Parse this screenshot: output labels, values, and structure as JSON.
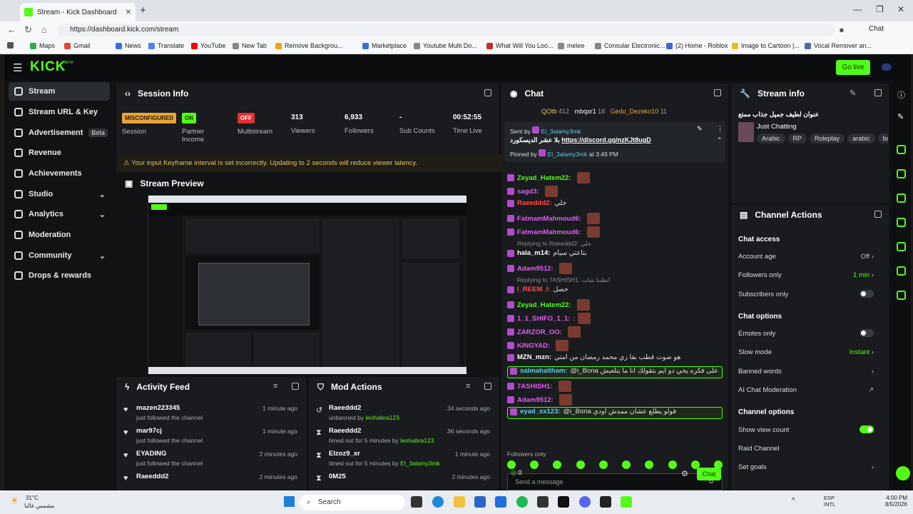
{
  "browser": {
    "tab_title": "Stream - Kick Dashboard",
    "url": "https://dashboard.kick.com/stream",
    "chat_label": "Chat",
    "bookmarks": [
      "Maps",
      "Gmail",
      "News",
      "Translate",
      "YouTube",
      "New Tab",
      "Remove Backgrou...",
      "Marketplace",
      "Youtube Multi Do...",
      "What Will You Loo...",
      "melee",
      "Consular Electronic...",
      "(2) Home - Roblox",
      "Image to Cartoon |...",
      "Vocal Remover an..."
    ]
  },
  "app": {
    "logo": "KICK",
    "logo_beta": "BETA",
    "go_live": "Go live"
  },
  "sidebar": {
    "items": [
      {
        "label": "Stream",
        "icon": "broadcast-icon"
      },
      {
        "label": "Stream URL & Key",
        "icon": "link-icon"
      },
      {
        "label": "Advertisement",
        "icon": "ad-icon",
        "badge": "Beta"
      },
      {
        "label": "Revenue",
        "icon": "revenue-icon"
      },
      {
        "label": "Achievements",
        "icon": "trophy-icon"
      },
      {
        "label": "Studio",
        "icon": "studio-icon"
      },
      {
        "label": "Analytics",
        "icon": "chart-icon"
      },
      {
        "label": "Moderation",
        "icon": "shield-icon"
      },
      {
        "label": "Community",
        "icon": "people-icon"
      },
      {
        "label": "Drops & rewards",
        "icon": "gift-icon"
      }
    ]
  },
  "session": {
    "title": "Session Info",
    "session_badge": "MISCONFIGURED",
    "session_label": "Session",
    "partner_badge": "ON",
    "partner_label": "Partner Income",
    "multistream_badge": "OFF",
    "multistream_label": "Multistream",
    "viewers": "313",
    "viewers_label": "Viewers",
    "followers": "6,933",
    "followers_label": "Followers",
    "subs": "-",
    "subs_label": "Sub Counts",
    "time": "00:52:55",
    "time_label": "Time Live",
    "warning": "Your input Keyframe interval is set incorrectly. Updating to 2 seconds will reduce viewer latency."
  },
  "preview": {
    "title": "Stream Preview"
  },
  "activity": {
    "title": "Activity Feed",
    "rows": [
      {
        "name": "mazen223345",
        "sub": "just followed the channel",
        "time": "1 minute ago"
      },
      {
        "name": "mar97cj",
        "sub": "just followed the channel",
        "time": "1 minute ago"
      },
      {
        "name": "EYADING",
        "sub": "just followed the channel",
        "time": "2 minutes ago"
      },
      {
        "name": "Raeeddd2",
        "sub": "",
        "time": "2 minutes ago"
      }
    ]
  },
  "mod": {
    "title": "Mod Actions",
    "rows": [
      {
        "name": "Raeeddd2",
        "sub": "unbanned by",
        "by": "leohabra123",
        "time": "34 seconds ago"
      },
      {
        "name": "Raeeddd2",
        "sub": "timed out for 5 minutes by",
        "by": "leohabra123",
        "time": "36 seconds ago"
      },
      {
        "name": "Elzoz9_xr",
        "sub": "timed out for 5 minutes by",
        "by": "El_3alamy3mk",
        "time": "1 minute ago"
      },
      {
        "name": "0M25",
        "sub": "",
        "by": "",
        "time": "2 minutes ago"
      }
    ]
  },
  "chat": {
    "title": "Chat",
    "top_gifters": [
      {
        "name": "QOtb",
        "count": "412"
      },
      {
        "name": "mbqxr1",
        "count": "18"
      },
      {
        "name": "Gedo_Dezeko10",
        "count": "11"
      }
    ],
    "pinned_sent_by_label": "Sent by",
    "pinned_sender": "El_3alamy3mk",
    "pinned_text": "بلا عشر الديسكورد",
    "pinned_link": "https://discord.gg/nzKJt8ugD",
    "pinned_by_label": "Pinned by",
    "pinned_by": "El_3alamy3mk",
    "pinned_time": "at 3:49 PM",
    "messages": [
      {
        "user": "Zeyad_Hatem22:",
        "color": "#53fc18",
        "text": "",
        "emote": true
      },
      {
        "user": "sagd3:",
        "color": "#e05cf2",
        "text": "",
        "emote": true
      },
      {
        "user": "Raeeddd2:",
        "color": "#ff4d4d",
        "text": "جلي",
        "emote": false
      },
      {
        "user": "FatmamMahmoud6:",
        "color": "#e05cf2",
        "text": "",
        "emote": true
      },
      {
        "user": "FatmamMahmoud6:",
        "color": "#e05cf2",
        "text": "",
        "emote": true
      },
      {
        "user": "hala_m14:",
        "color": "#fff",
        "text": "بتاعتي سيام",
        "emote": false,
        "reply": "Replying to Raeeddd2: جلي"
      },
      {
        "user": "Adam9512:",
        "color": "#e05cf2",
        "text": "",
        "emote": true
      },
      {
        "user": "I_REEM_I:",
        "color": "#ff4d4d",
        "text": "حصل",
        "emote": false,
        "reply": "Replying to 7ASHISH1: انطبنا شات"
      },
      {
        "user": "Zeyad_Hatem22:",
        "color": "#53fc18",
        "text": "",
        "emote": true
      },
      {
        "user": "1_1_SHIFO_1_1:",
        "color": "#e05cf2",
        "text": ":",
        "emote": true
      },
      {
        "user": "ZARZOR_OO:",
        "color": "#e05cf2",
        "text": "",
        "emote": true
      },
      {
        "user": "KINGYAD:",
        "color": "#e05cf2",
        "text": "",
        "emote": true
      },
      {
        "user": "MZN_mzn:",
        "color": "#fff",
        "text": "هو صوت قطب بقا زي محمد رمضان من امتي",
        "emote": false
      },
      {
        "user": "salmahaitham:",
        "color": "#5ec9f5",
        "text": "@i_Bona على فكره يحي دو ايم بتقولك انا ما بتلعبش",
        "emote": false,
        "highlight": true
      },
      {
        "user": "7ASHISH1:",
        "color": "#e05cf2",
        "text": "",
        "emote": true
      },
      {
        "user": "Adam9512:",
        "color": "#e05cf2",
        "text": "",
        "emote": true
      },
      {
        "user": "eyad_xx123:",
        "color": "#5ec9f5",
        "text": "@i_Bona قولو يطلع عشان ممدش اودي",
        "emote": false,
        "highlight": true
      }
    ],
    "followers_only": "Followers only",
    "input_placeholder": "Send a message",
    "points": "0",
    "send_label": "Chat"
  },
  "stream_info": {
    "title": "Stream info",
    "stream_title": "عنوان لطيف جميل جذاب ممتع",
    "category": "Just Chatting",
    "tags": [
      "Arabic",
      "RP",
      "Roleplay",
      "arabic",
      "bor"
    ]
  },
  "channel_actions": {
    "title": "Channel Actions",
    "chat_access": "Chat access",
    "account_age": "Account age",
    "account_age_value": "Off",
    "followers_only": "Followers only",
    "followers_only_value": "1 min",
    "subscribers_only": "Subscribers only",
    "chat_options": "Chat options",
    "emotes_only": "Emotes only",
    "slow_mode": "Slow mode",
    "slow_mode_value": "Instant",
    "banned_words": "Banned words",
    "ai_moderation": "AI Chat Moderation",
    "channel_options": "Channel options",
    "show_view_count": "Show view count",
    "raid_channel": "Raid Channel",
    "set_goals": "Set goals"
  },
  "taskbar": {
    "weather_temp": "31°C",
    "weather_desc": "مشمس غالبا",
    "search": "Search",
    "lang": "ESP",
    "lang2": "INTL",
    "time": "4:00 PM",
    "date": "8/5/2026"
  },
  "colors": {
    "accent": "#53fc18",
    "bg": "#111214",
    "panel": "#191b1e"
  }
}
